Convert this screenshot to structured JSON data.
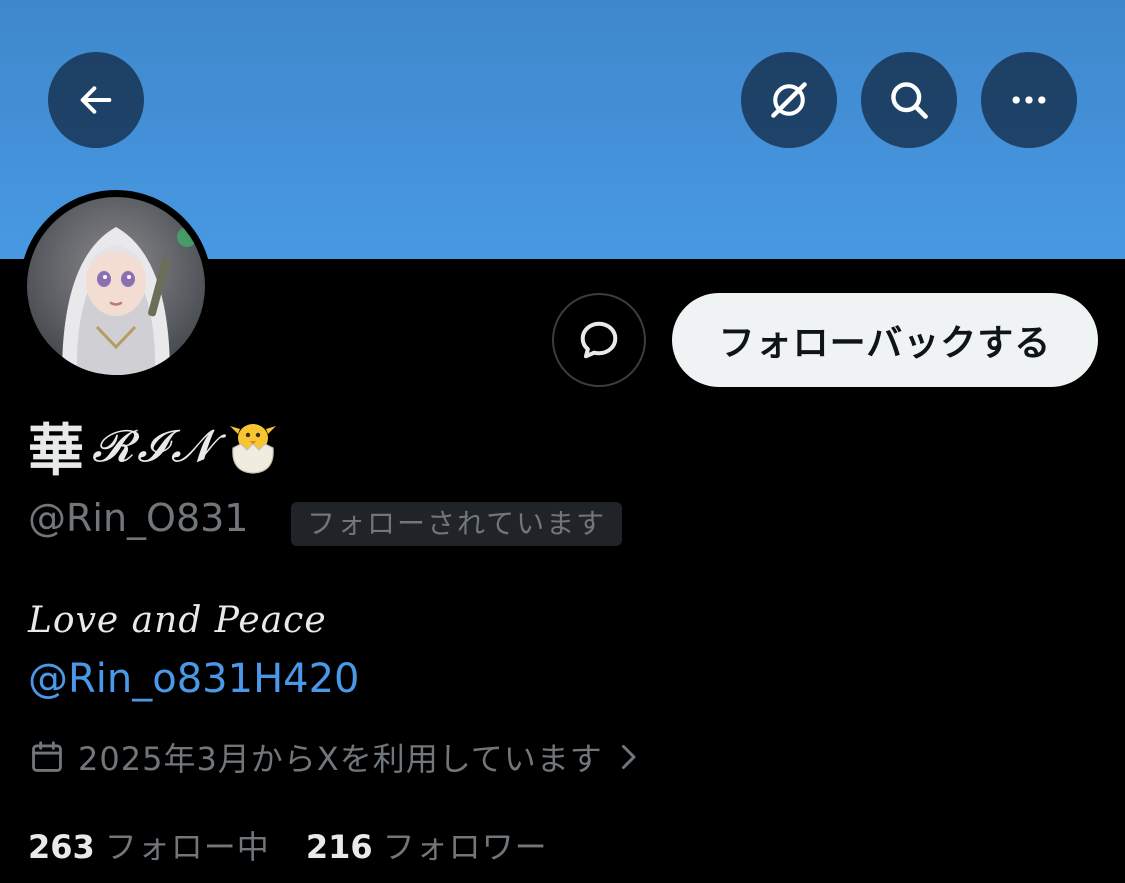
{
  "header": {
    "back_icon": "arrow-left-icon",
    "grok_icon": "grok-icon",
    "search_icon": "search-icon",
    "more_icon": "more-horizontal-icon",
    "banner_color": "#4799e3"
  },
  "profile": {
    "avatar_icon": "avatar-image",
    "name_kanji": "華",
    "name_latin": "𝓡𝓘𝓝",
    "name_emoji_icon": "hatching-chick-icon",
    "handle": "@Rin_O831",
    "follows_you_badge": "フォローされています",
    "bio": "Love and Peace",
    "bio_link": "@Rin_o831H420",
    "joined": "2025年3月からXを利用しています",
    "joined_icon": "calendar-icon",
    "following_count": "263",
    "following_label": "フォロー中",
    "followers_count": "216",
    "followers_label": "フォロワー"
  },
  "actions": {
    "message_icon": "message-icon",
    "follow_back_label": "フォローバックする"
  },
  "colors": {
    "background": "#000000",
    "link": "#4a99e9",
    "secondary_text": "#71767b",
    "primary_text": "#e7e9ea"
  }
}
